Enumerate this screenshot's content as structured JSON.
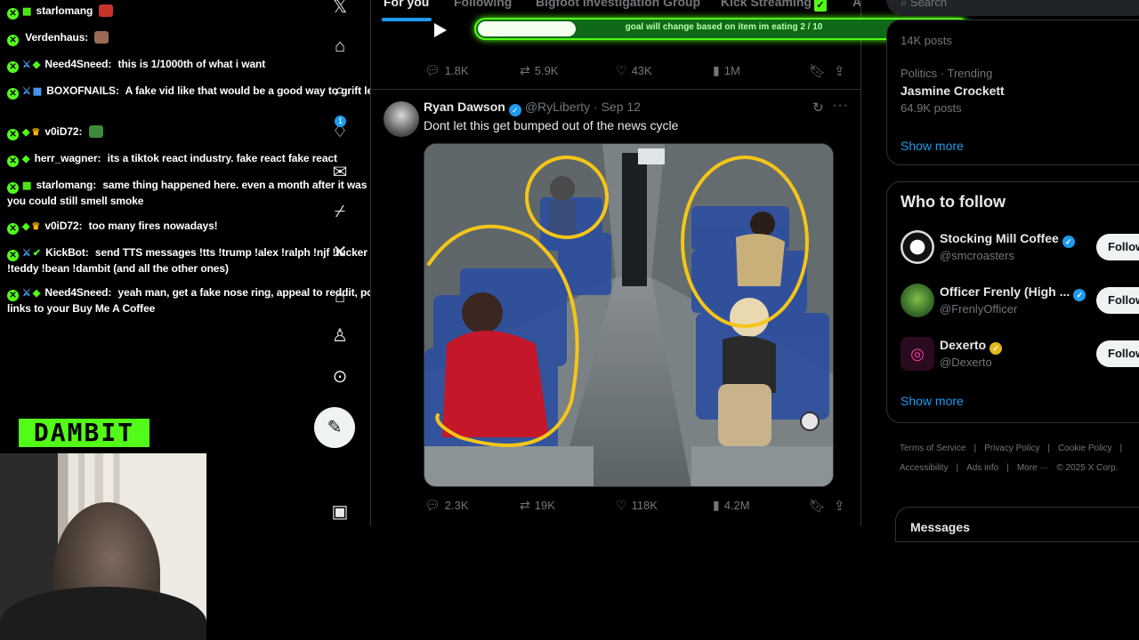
{
  "chat": {
    "messages": [
      {
        "user": "starlomang",
        "text": "",
        "color": "#53fc18"
      },
      {
        "user": "Verdenhaus:",
        "text": "",
        "color": "#53fc18"
      },
      {
        "user": "Need4Sneed:",
        "text": "this is 1/1000th of what i want",
        "color": "#53fc18"
      },
      {
        "user": "BOXOFNAILS:",
        "text": "A fake vid like that would be a good way to grift leftists",
        "color": "#53fc18"
      },
      {
        "user": "v0iD72:",
        "text": "",
        "color": "#53fc18"
      },
      {
        "user": "herr_wagner:",
        "text": "its a tiktok react industry. fake react fake react",
        "color": "#53fc18"
      },
      {
        "user": "starlomang:",
        "text": "same thing happened here. even a month after it was out, you could still smell smoke",
        "color": "#53fc18"
      },
      {
        "user": "v0iD72:",
        "text": "too many fires nowadays!",
        "color": "#53fc18"
      },
      {
        "user": "KickBot:",
        "text": "send TTS messages !tts !trump !alex !ralph !njf !tucker !teddy !bean !dambit (and all the other ones)",
        "color": "#53fc18"
      },
      {
        "user": "Need4Sneed:",
        "text": "yeah man, get a fake nose ring, appeal to reddit, post links to your Buy Me A Coffee",
        "color": "#53fc18"
      }
    ]
  },
  "stream": {
    "logo_text": "DAMBIT",
    "goal_text": "goal will change based on item im eating 2 / 10",
    "goal_progress": 0.2
  },
  "timeline": {
    "tabs": [
      "For you",
      "Following",
      "Bigfoot Investigation Group",
      "Kick Streaming",
      "A"
    ],
    "prev_post": {
      "replies": "1.8K",
      "reposts": "5.9K",
      "likes": "43K",
      "views": "1M"
    },
    "post": {
      "name": "Ryan Dawson",
      "handle": "@RyLiberty",
      "date": "· Sep 12",
      "text": "Dont let this get bumped out of the news cycle",
      "replies": "2.3K",
      "reposts": "19K",
      "likes": "118K",
      "views": "4.2M"
    }
  },
  "sidebar": {
    "search_placeholder": "Search",
    "trend_prev_count": "14K posts",
    "trend": {
      "category": "Politics · Trending",
      "name": "Jasmine Crockett",
      "count": "64.9K posts"
    },
    "show_more": "Show more",
    "who_to_follow": {
      "title": "Who to follow",
      "accounts": [
        {
          "name": "Stocking Mill Coffee",
          "handle": "@smcroasters",
          "button": "Follow"
        },
        {
          "name": "Officer Frenly (High ...",
          "handle": "@FrenlyOfficer",
          "button": "Follow"
        },
        {
          "name": "Dexerto",
          "handle": "@Dexerto",
          "button": "Follow"
        }
      ],
      "show_more": "Show more"
    },
    "footer": [
      "Terms of Service",
      "|",
      "Privacy Policy",
      "|",
      "Cookie Policy",
      "|",
      "Accessibility",
      "|",
      "Ads info",
      "|",
      "More ···",
      "© 2025 X Corp."
    ],
    "messages_title": "Messages"
  },
  "colors": {
    "kick_green": "#53fc18",
    "x_blue": "#1d9bf0",
    "annotation_yellow": "#f5c518"
  }
}
